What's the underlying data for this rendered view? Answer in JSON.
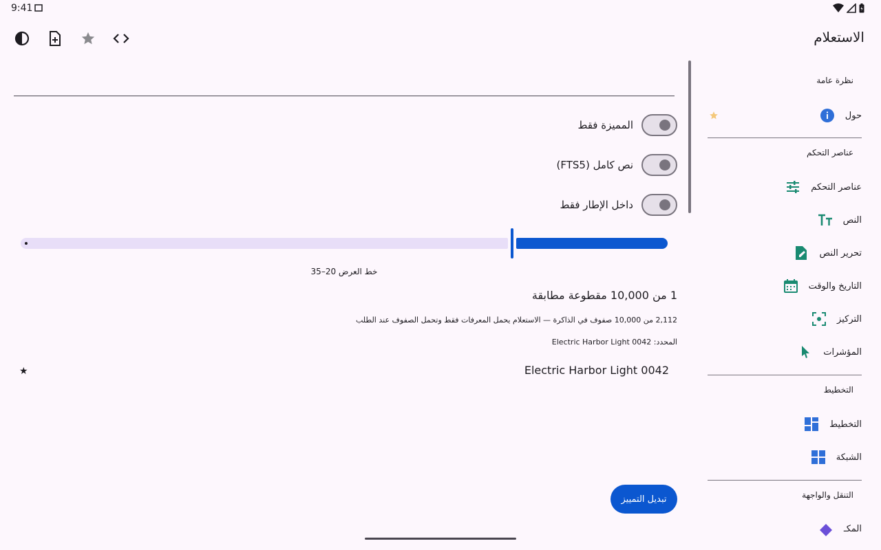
{
  "status": {
    "time": "9:41"
  },
  "toolbar": {
    "title": "الاستعلام",
    "icons": [
      "contrast-icon",
      "add-document-icon",
      "star-icon",
      "code-icon"
    ]
  },
  "filters": {
    "starred_only": "المميزة فقط",
    "full_text": "نص كامل (FTS5)",
    "in_frame_only": "داخل الإطار فقط"
  },
  "slider": {
    "caption": "خط العرض 20–35",
    "value_fraction": 0.23
  },
  "results": {
    "match_title": "1 من 10,000 مقطوعة مطابقة",
    "memory_note": "2,112 من 10,000 صفوف في الذاكرة — الاستعلام يحمل المعرفات فقط وتحمل الصفوف عند الطلب",
    "selected_note": "المحدد: Electric Harbor Light 0042",
    "items": [
      {
        "title": "Electric Harbor Light 0042",
        "star": "★"
      }
    ]
  },
  "action": {
    "toggle_star": "تبديل التمييز"
  },
  "sidebar": {
    "sections": {
      "overview": "نظرة عامة",
      "controls": "عناصر التحكم",
      "layout": "التخطيط",
      "navigation": "التنقل والواجهة"
    },
    "items": {
      "about": "حول",
      "controls": "عناصر التحكم",
      "text": "النص",
      "text_edit": "تحرير النص",
      "datetime": "التاريخ والوقت",
      "focus": "التركيز",
      "pointers": "المؤشرات",
      "layout": "التخطيط",
      "grid": "الشبكة",
      "partial": "المكـ"
    }
  },
  "colors": {
    "background": "#fdf7fd",
    "accent": "#0b57d0",
    "sidebar_teal": "#198a71",
    "sidebar_blue": "#2f6fd8"
  }
}
